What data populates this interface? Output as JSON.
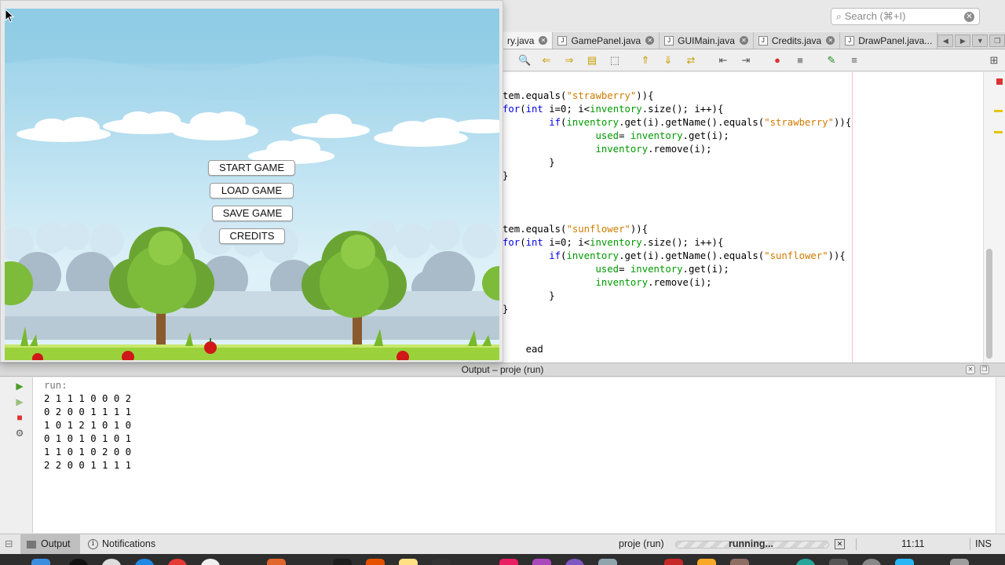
{
  "ide": {
    "search_placeholder": "Search (⌘+I)",
    "tabs": [
      {
        "label": "ry.java"
      },
      {
        "label": "GamePanel.java"
      },
      {
        "label": "GUIMain.java"
      },
      {
        "label": "Credits.java"
      },
      {
        "label": "DrawPanel.java..."
      }
    ],
    "code_lines": [
      "tem.equals(\"strawberry\")){",
      "for(int i=0; i<inventory.size(); i++){",
      "        if(inventory.get(i).getName().equals(\"strawberry\")){",
      "                used= inventory.get(i);",
      "                inventory.remove(i);",
      "        }",
      "}",
      "",
      "",
      "",
      "tem.equals(\"sunflower\")){",
      "for(int i=0; i<inventory.size(); i++){",
      "        if(inventory.get(i).getName().equals(\"sunflower\")){",
      "                used= inventory.get(i);",
      "                inventory.remove(i);",
      "        }",
      "}",
      "",
      "",
      "    ead"
    ]
  },
  "output": {
    "title": "Output – proje (run)",
    "run_label": "run:",
    "lines": [
      "2 1 1 1 0 0 0 2",
      "0 2 0 0 1 1 1 1",
      "1 0 1 2 1 0 1 0",
      "0 1 0 1 0 1 0 1",
      "1 1 0 1 0 2 0 0",
      "2 2 0 0 1 1 1 1"
    ]
  },
  "statusbar": {
    "output_label": "Output",
    "notifications_label": "Notifications",
    "project_run": "proje (run)",
    "running": "running...",
    "time": "11:11",
    "mode": "INS"
  },
  "game": {
    "buttons": {
      "start": "START GAME",
      "load": "LOAD GAME",
      "save": "SAVE GAME",
      "credits": "CREDITS"
    }
  },
  "colors": {
    "sky_top": "#8ecbe6",
    "grass": "#9bd23c",
    "keyword": "#0000e6",
    "string": "#ce7b00",
    "field": "#009900"
  }
}
